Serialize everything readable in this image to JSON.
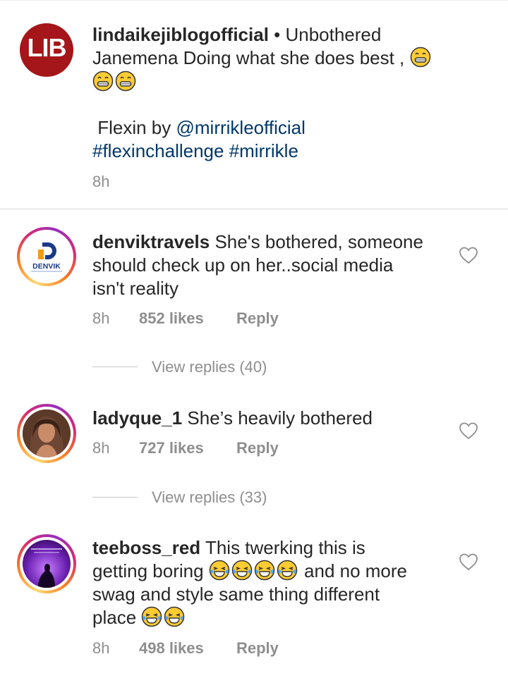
{
  "caption": {
    "username": "lindaikejiblogofficial",
    "avatar_text": "LIB",
    "line1_rest": " • Unbothered",
    "line2": "Janemena Doing what she does best ,",
    "line3_prefix": " Flexin by ",
    "mention": "@mirrikleofficial",
    "hashtags": "#flexinchallenge #mirrikle",
    "time": "8h"
  },
  "comments": [
    {
      "username": "denviktravels",
      "avatar_text": "DENVIK",
      "lines": [
        "She's bothered, someone",
        "should check up on her..social media",
        "isn't reality"
      ],
      "time": "8h",
      "likes": "852 likes",
      "reply": "Reply",
      "view_replies": "View replies (40)"
    },
    {
      "username": "ladyque_1",
      "lines": [
        "She’s heavily bothered"
      ],
      "time": "8h",
      "likes": "727 likes",
      "reply": "Reply",
      "view_replies": "View replies (33)"
    },
    {
      "username": "teeboss_red",
      "lines": [
        "This twerking this is",
        "getting boring",
        "and no more",
        "swag and style same thing different",
        "place"
      ],
      "time": "8h",
      "likes": "498 likes",
      "reply": "Reply"
    }
  ],
  "icons": {
    "heart": "heart-outline-icon",
    "grin": "grinning-face-emoji",
    "laugh": "tears-of-joy-emoji"
  },
  "colors": {
    "lib_red": "#a4161a",
    "link": "#00376b",
    "muted": "#8e8e8e"
  }
}
